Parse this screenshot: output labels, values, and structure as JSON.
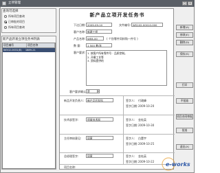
{
  "window": {
    "title": "立项管理"
  },
  "left": {
    "query_group_title": "查询可选择",
    "radios": [
      {
        "label": "所有项目查询",
        "checked": false
      },
      {
        "label": "已审批的项目",
        "checked": true
      },
      {
        "label": "所有项目查询",
        "checked": false
      }
    ],
    "list_title": "新产品开发立项任务书列表",
    "columns": [
      "项目编号",
      "项目名称"
    ],
    "rows": [
      [
        "WO02-0031(B)",
        "1889-21"
      ]
    ]
  },
  "form": {
    "title": "新产品立项开发任务书",
    "date_label": "下达日期:",
    "date_value": "2009-09-10",
    "doc_no_label": "文件编号:",
    "doc_no_value": "WS102-00010-000",
    "client_label": "客户名称:",
    "client_value": "新建工程",
    "product_no_label": "产品名称:",
    "product_no_value": "WE8-00",
    "product_no_note": "( 个别零件同样购一件号 )",
    "model_label": "数  量:",
    "model_value": "1 500 套/年",
    "req_label": "客户要求:",
    "req_lines": [
      "1. 按客户所有零件号 · 品质控制。",
      "2. 开模工艺等",
      "3. 资料提供的"
    ],
    "confirm_label": "客户要求确认:",
    "confirm_value": "是",
    "rows": [
      {
        "left_label": "新品开发负责人:",
        "left_value": "新产品开发科",
        "right_label": "签字人:",
        "right_value": "付政峰",
        "date_label": "签字日期:",
        "date_value": "2009-10-20"
      },
      {
        "left_label": "技术部签字:",
        "left_value": "质量技术部",
        "right_label": "签字人:",
        "right_value": "金桂英",
        "date_label": "签字日期:",
        "date_value": "2009-10-30"
      },
      {
        "left_label": "主任审核意见:",
        "left_value": "同意",
        "right_label": "签字人:",
        "right_value": "白董宇",
        "date_label": "签字日期:",
        "date_value": "2009-10-25"
      },
      {
        "left_label": "总经理签字:",
        "left_value": "同意",
        "right_label": "签字人:",
        "right_value": "金桂英",
        "date_label": "签字日期:",
        "date_value": "2009-10-22"
      }
    ],
    "bottom_label": "项目名称:"
  },
  "buttons": [
    "新增(A)",
    "修改(E)",
    "删除(D)",
    "保存(S)",
    "打印",
    "不批准",
    "项目合同审批",
    "批准",
    "退出(X)"
  ],
  "watermark": "e-works"
}
